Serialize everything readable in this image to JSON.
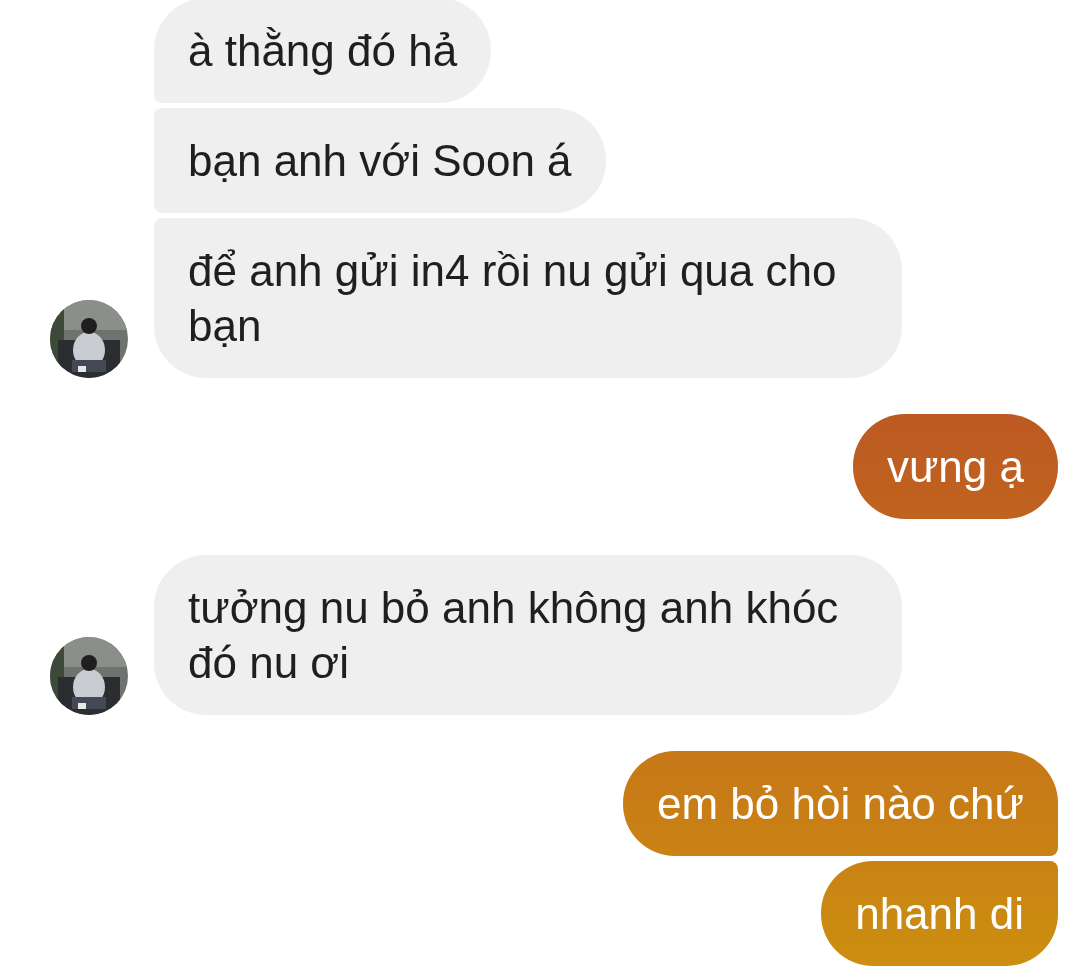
{
  "groups": [
    {
      "kind": "received",
      "avatar": true,
      "messages": [
        {
          "text": "à thằng đó hả"
        },
        {
          "text": "bạn anh với Soon á"
        },
        {
          "text": "để anh gửi in4 rồi nu gửi qua cho bạn"
        }
      ]
    },
    {
      "kind": "sent",
      "messages": [
        {
          "text": "vưng ạ"
        }
      ]
    },
    {
      "kind": "received",
      "avatar": true,
      "messages": [
        {
          "text": "tưởng nu bỏ anh không anh khóc đó nu ơi"
        }
      ]
    },
    {
      "kind": "sent",
      "messages": [
        {
          "text": "em bỏ hòi nào chứ"
        },
        {
          "text": "nhanh di"
        }
      ]
    }
  ]
}
